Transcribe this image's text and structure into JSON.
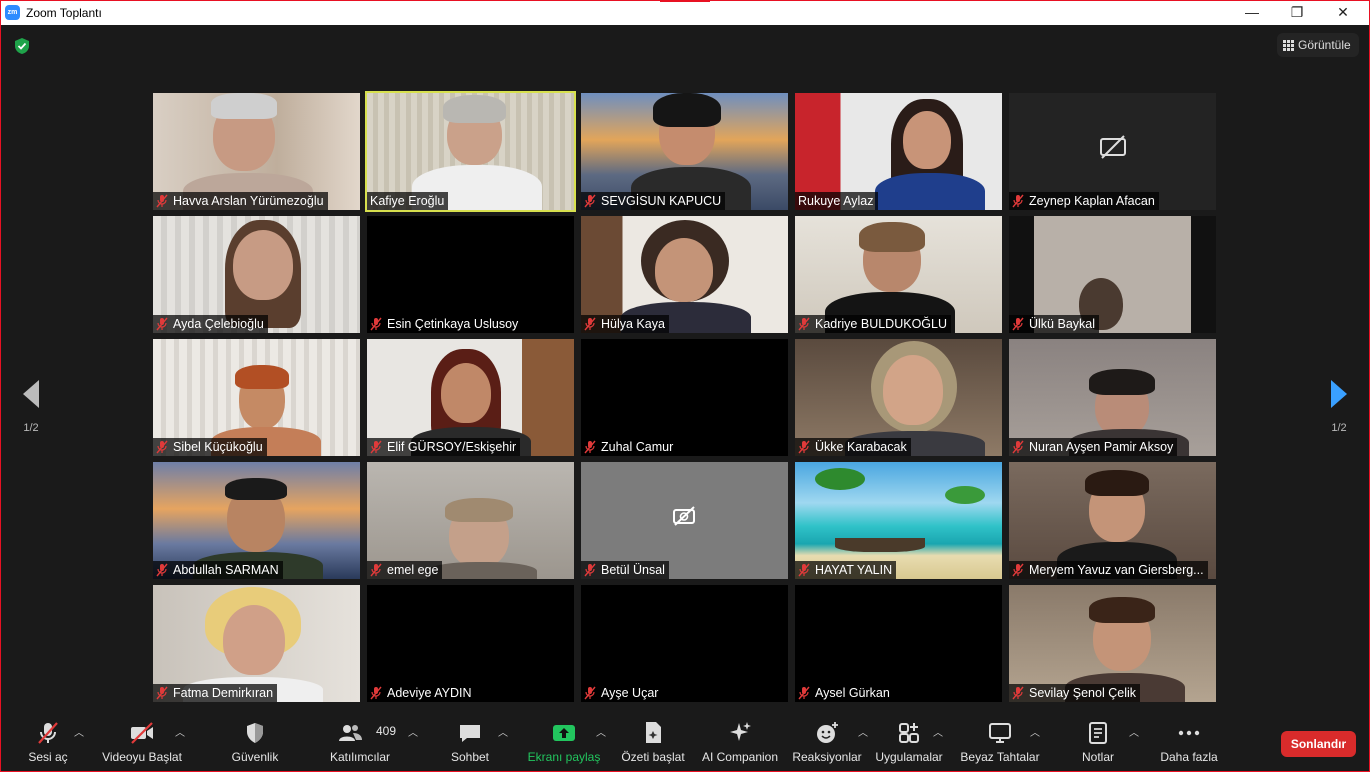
{
  "window": {
    "title": "Zoom Toplantı",
    "minimize": "—",
    "restore": "❐",
    "close": "✕"
  },
  "header": {
    "view_label": "Görüntüle"
  },
  "pagination": {
    "left": "1/2",
    "right": "1/2"
  },
  "participants": [
    {
      "name": "Havva Arslan Yürümezoğlu",
      "video": "on"
    },
    {
      "name": "Kafiye Eroğlu",
      "video": "on",
      "active_speaker": true
    },
    {
      "name": "SEVGİSUN KAPUCU",
      "video": "on"
    },
    {
      "name": "Rukuye Aylaz",
      "video": "on"
    },
    {
      "name": "Zeynep Kaplan Afacan",
      "video": "off"
    },
    {
      "name": "Ayda Çelebioğlu",
      "video": "on"
    },
    {
      "name": "Esin Çetinkaya Uslusoy",
      "video": "black"
    },
    {
      "name": "Hülya Kaya",
      "video": "on"
    },
    {
      "name": "Kadriye BULDUKOĞLU",
      "video": "on"
    },
    {
      "name": "Ülkü Baykal",
      "video": "on"
    },
    {
      "name": "Sibel Küçükoğlu",
      "video": "on"
    },
    {
      "name": "Elif GÜRSOY/Eskişehir",
      "video": "on"
    },
    {
      "name": "Zuhal Camur",
      "video": "black"
    },
    {
      "name": "Ükke Karabacak",
      "video": "on"
    },
    {
      "name": "Nuran Ayşen Pamir Aksoy",
      "video": "on"
    },
    {
      "name": "Abdullah SARMAN",
      "video": "on"
    },
    {
      "name": "emel ege",
      "video": "on"
    },
    {
      "name": "Betül Ünsal",
      "video": "off"
    },
    {
      "name": "HAYAT YALIN",
      "video": "on"
    },
    {
      "name": "Meryem Yavuz van Giersberg...",
      "video": "on"
    },
    {
      "name": "Fatma Demirkıran",
      "video": "on"
    },
    {
      "name": "Adeviye AYDIN",
      "video": "black"
    },
    {
      "name": "Ayşe Uçar",
      "video": "black"
    },
    {
      "name": "Aysel Gürkan",
      "video": "black"
    },
    {
      "name": "Sevilay Şenol Çelik",
      "video": "on"
    }
  ],
  "toolbar": {
    "audio": "Sesi aç",
    "video": "Videoyu Başlat",
    "security": "Güvenlik",
    "participants": "Katılımcılar",
    "participant_count": "409",
    "chat": "Sohbet",
    "share": "Ekranı paylaş",
    "summary": "Özeti başlat",
    "ai": "AI Companion",
    "reactions": "Reaksiyonlar",
    "apps": "Uygulamalar",
    "whiteboard": "Beyaz Tahtalar",
    "notes": "Notlar",
    "more": "Daha fazla",
    "end": "Sonlandır"
  },
  "colors": {
    "share_green": "#22c55e",
    "end_red": "#d92b2b",
    "active_speaker": "#d7e04e",
    "nav_blue": "#3aa0ff"
  }
}
